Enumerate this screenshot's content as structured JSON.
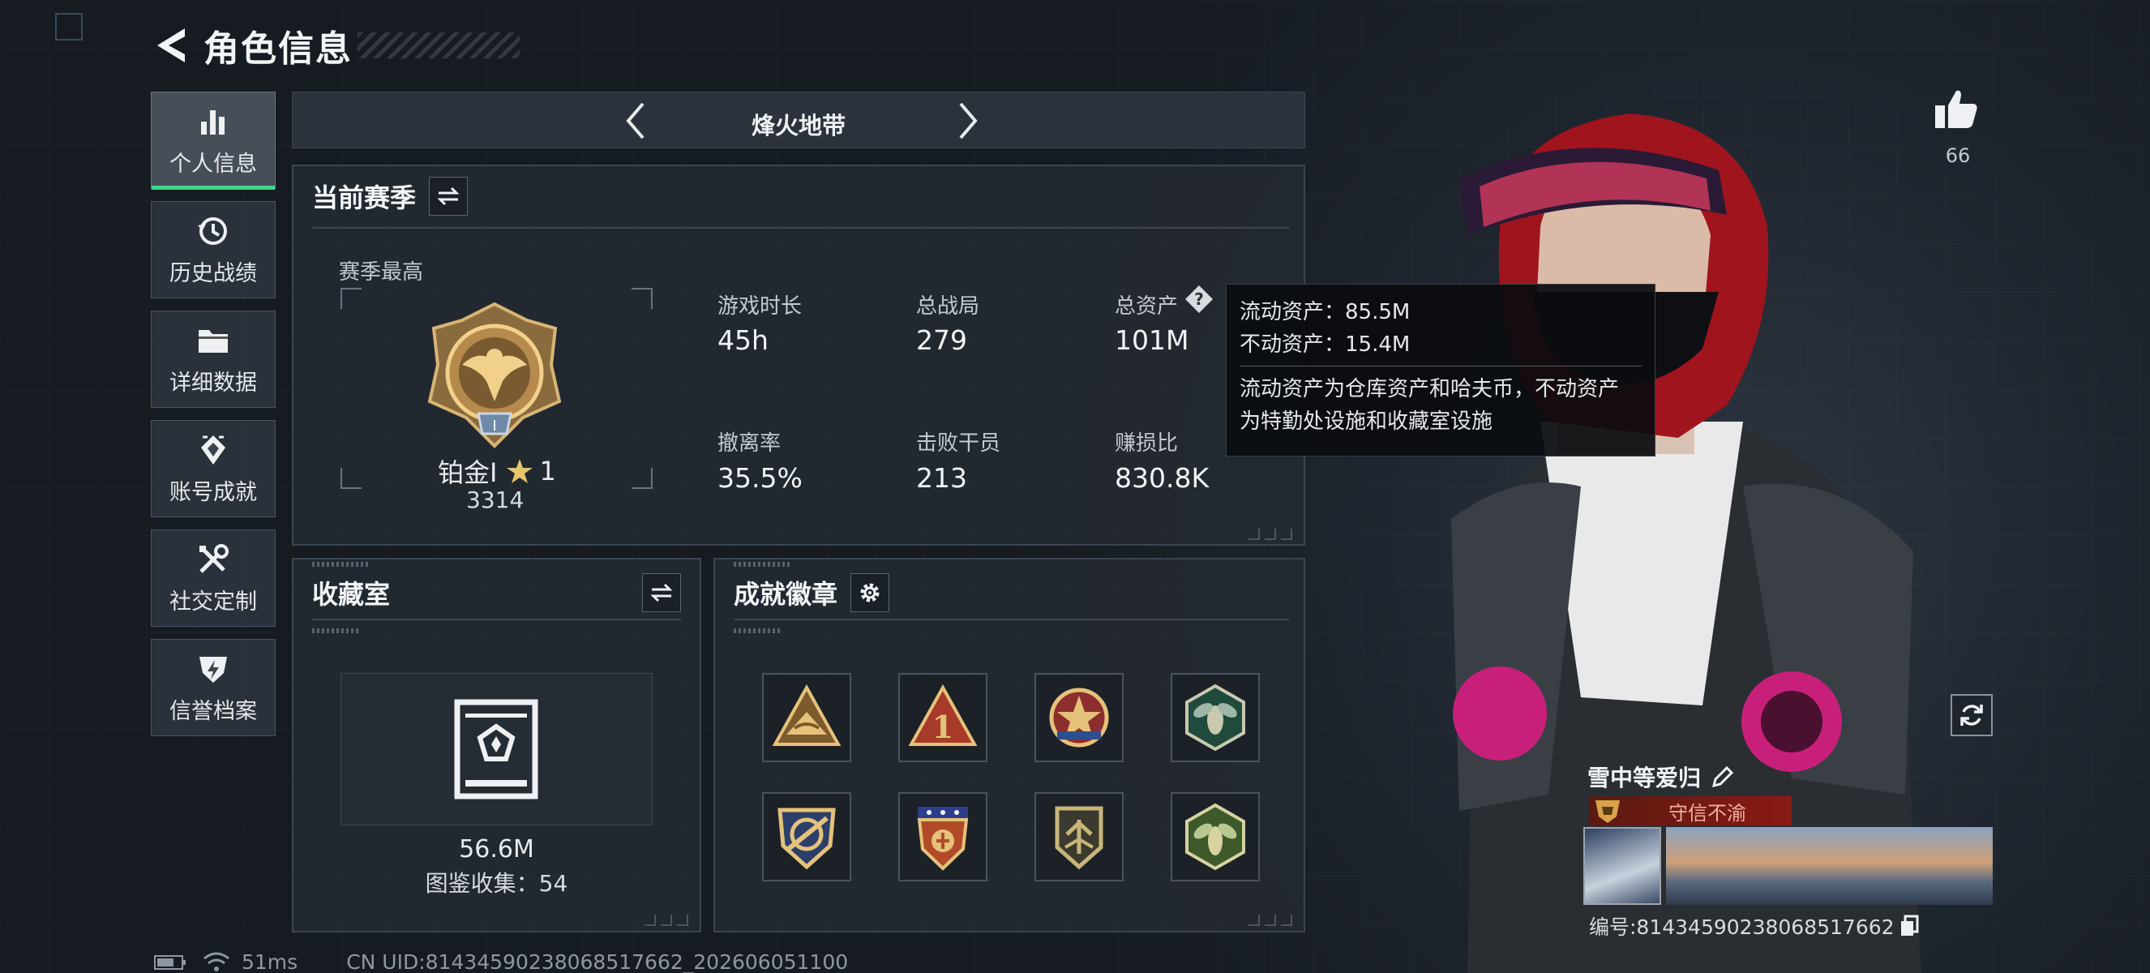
{
  "header": {
    "title": "角色信息"
  },
  "sidebar": {
    "items": [
      {
        "label": "个人信息",
        "icon": "bar-chart-icon",
        "active": true
      },
      {
        "label": "历史战绩",
        "icon": "history-icon"
      },
      {
        "label": "详细数据",
        "icon": "folder-icon"
      },
      {
        "label": "账号成就",
        "icon": "achievement-icon"
      },
      {
        "label": "社交定制",
        "icon": "tools-icon"
      },
      {
        "label": "信誉档案",
        "icon": "shield-bolt-icon"
      }
    ]
  },
  "mode": {
    "title": "烽火地带"
  },
  "season": {
    "title": "当前赛季",
    "best_label": "赛季最高",
    "rank_name": "铂金I",
    "rank_stars": "1",
    "rank_score": "3314",
    "stats": [
      {
        "label": "游戏时长",
        "value": "45h"
      },
      {
        "label": "总战局",
        "value": "279"
      },
      {
        "label": "总资产",
        "value": "101M"
      },
      {
        "label": "撤离率",
        "value": "35.5%"
      },
      {
        "label": "击败干员",
        "value": "213"
      },
      {
        "label": "赚损比",
        "value": "830.8K"
      }
    ]
  },
  "tooltip": {
    "liquid": "流动资产：85.5M",
    "fixed": "不动资产：15.4M",
    "desc_1": "流动资产为仓库资产和哈夫币，不动资产",
    "desc_2": "为特勤处设施和收藏室设施"
  },
  "collection": {
    "title": "收藏室",
    "value": "56.6M",
    "count": "图鉴收集：54"
  },
  "badges": {
    "title": "成就徽章",
    "items": [
      "mountain-badge-icon",
      "number-one-badge-icon",
      "star-badge-icon",
      "bee-badge-icon",
      "anchor-shield-badge-icon",
      "stars-shield-badge-icon",
      "wings-badge-icon",
      "bee-green-badge-icon"
    ]
  },
  "likes": {
    "count": "66"
  },
  "player": {
    "name": "雪中等爱归",
    "tag": "守信不渝",
    "uid_line": "编号:8143459023806851​7662"
  },
  "status": {
    "ping": "51ms",
    "uid": "CN UID:8143459023806851​7662_202606051100"
  }
}
